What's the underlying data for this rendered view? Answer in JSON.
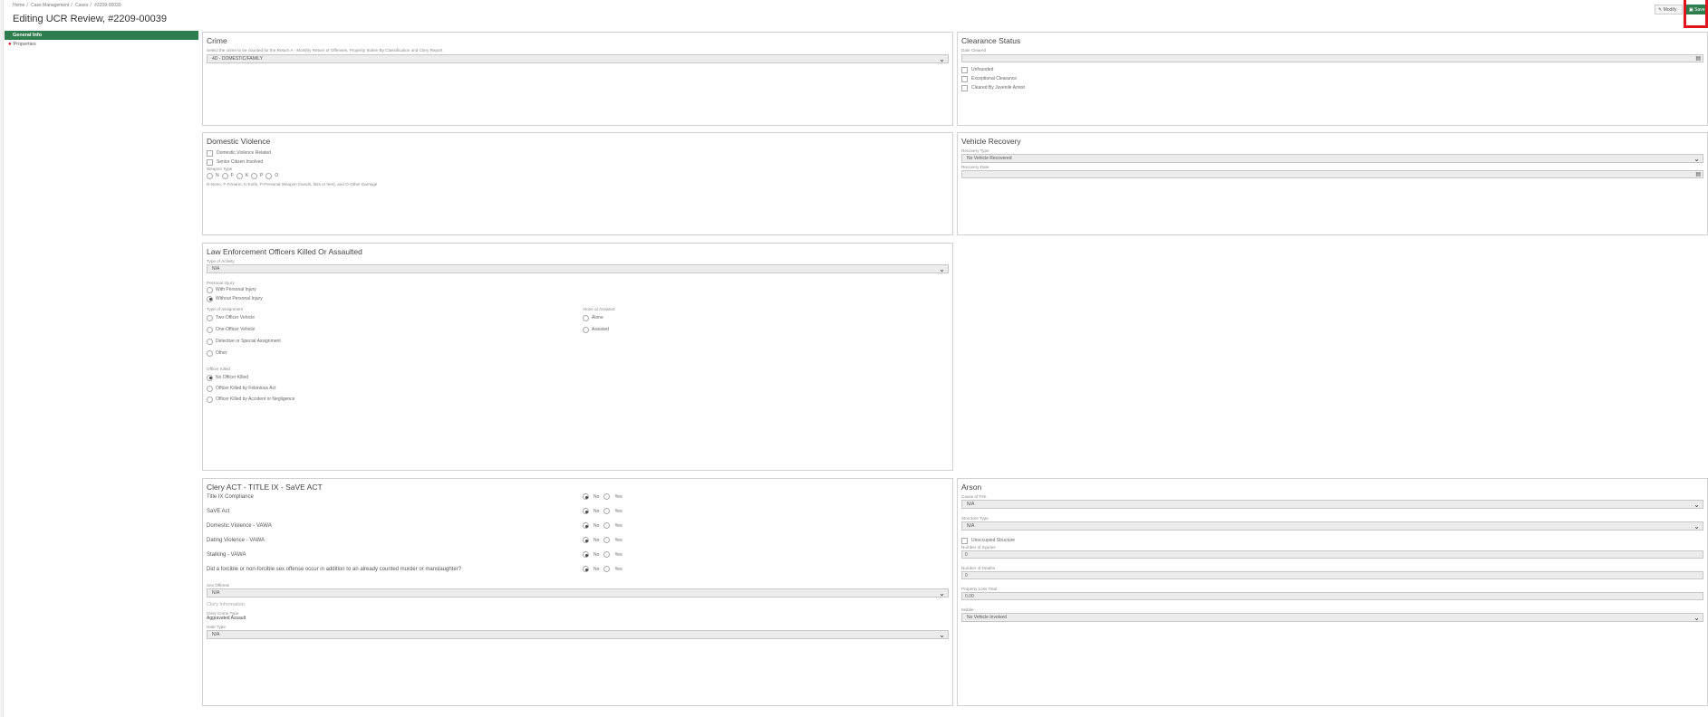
{
  "breadcrumb": [
    "Home",
    "/",
    "Case Management",
    "/",
    "Cases",
    "/",
    "#2209-00039"
  ],
  "page_title": "Editing UCR Review, #2209-00039",
  "toolbar": {
    "modify_label": "Modify",
    "save_label": "Save"
  },
  "sidenav": {
    "items": [
      {
        "label": "General Info"
      },
      {
        "label": "Properties"
      }
    ]
  },
  "crime": {
    "title": "Crime",
    "help": "Select the crime to be counted for the Return A - Monthly Return of Offenses, Property Stolen By Classification and Clery Report",
    "selected": "4D - DOMESTIC/FAMILY"
  },
  "clearance": {
    "title": "Clearance Status",
    "date_label": "Date Cleared",
    "date_value": "",
    "checks": [
      "Unfounded",
      "Exceptional Clearance",
      "Cleared By Juvenile Arrest"
    ]
  },
  "domestic": {
    "title": "Domestic Violence",
    "checks": [
      "Domestic Violence Related",
      "Senior Citizen Involved"
    ],
    "weapon_label": "Weapon Type",
    "weapon_options": [
      "N",
      "F",
      "K",
      "P",
      "O"
    ],
    "weapon_note": "N-None, F-Firearm, K-Knife, P-Personal Weapon (hands, fists or feet), and O-Other Damage"
  },
  "vehicle": {
    "title": "Vehicle Recovery",
    "type_label": "Recovery Type",
    "type_value": "No Vehicle Recovered",
    "date_label": "Recovery Date",
    "date_value": ""
  },
  "leoka": {
    "title": "Law Enforcement Officers Killed Or Assaulted",
    "activity_label": "Type of Activity",
    "activity_value": "N/A",
    "injury_label": "Personal Injury",
    "injury_options": [
      "With Personal Injury",
      "Without Personal Injury"
    ],
    "assignment_label": "Type of Assignment",
    "assignment_options": [
      "Two-Officer Vehicle",
      "One-Officer Vehicle",
      "Detective or Special Assignment",
      "Other"
    ],
    "alone_label": "Alone or Assisted",
    "alone_options": [
      "Alone",
      "Assisted"
    ],
    "killed_label": "Officer Killed",
    "killed_options": [
      "No Officer Killed",
      "Officer Killed by Felonious Act",
      "Officer Killed by Accident or Negligence"
    ]
  },
  "clery": {
    "title": "Clery ACT - TITLE IX - SaVE ACT",
    "questions": [
      "Title IX Compliance",
      "SaVE Act",
      "Domestic Violence - VAWA",
      "Dating Violence - VAWA",
      "Stalking - VAWA",
      "Did a forcible or non-forcible sex offense occur in addition to an already counted murder or manslaughter?"
    ],
    "no_label": "No",
    "yes_label": "Yes",
    "sex_offense_label": "Sex Offense",
    "sex_offense_value": "N/A",
    "info_label": "Clery Information",
    "crime_type_label": "Clery Crime Type",
    "crime_type_value": "Aggravated Assault",
    "hate_label": "Hate Type",
    "hate_value": "N/A"
  },
  "arson": {
    "title": "Arson",
    "cause_label": "Cause of Fire",
    "cause_value": "N/A",
    "structure_label": "Structure Type",
    "structure_value": "N/A",
    "unoccupied_label": "Unoccupied Structure",
    "injuries_label": "Number of Injuries",
    "injuries_value": "0",
    "deaths_label": "Number of Deaths",
    "deaths_value": "0",
    "loss_label": "Property Loss Total",
    "loss_value": "0.00",
    "mobile_label": "Mobile",
    "mobile_value": "No Vehicle Involved"
  }
}
